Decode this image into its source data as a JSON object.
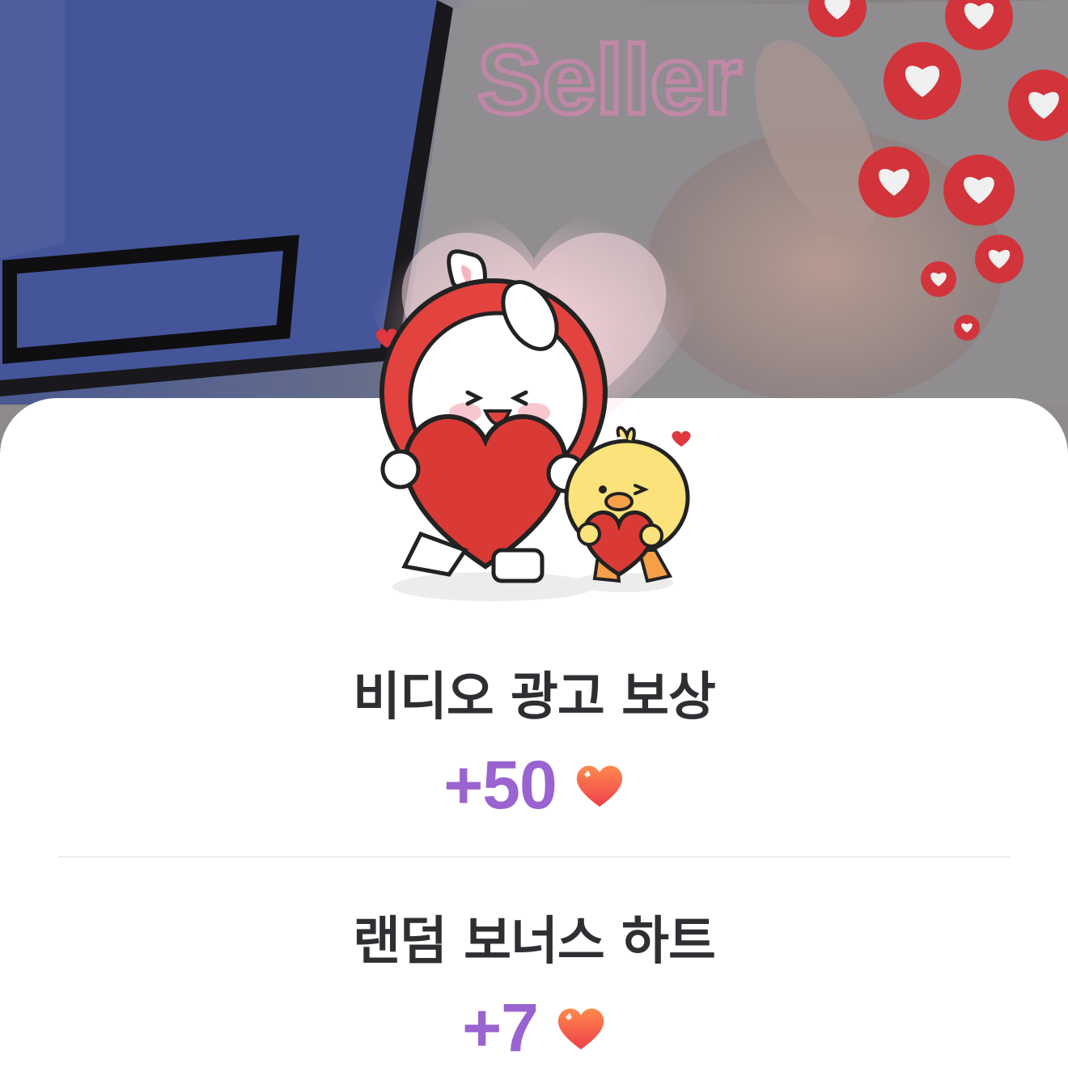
{
  "background": {
    "description_icon": "video-frame",
    "floating_hearts_icon": "heart-bubbles-icon"
  },
  "mascot": {
    "icon": "rabbit-and-chick-holding-hearts-icon"
  },
  "rewards": [
    {
      "title": "비디오 광고 보상",
      "amount": "+50",
      "icon": "heart-icon"
    },
    {
      "title": "랜덤 보너스 하트",
      "amount": "+7",
      "icon": "heart-icon"
    }
  ],
  "colors": {
    "accent": "#9a63d0",
    "title": "#2f2f33",
    "heart_top": "#ff7a4a",
    "heart_bottom": "#f0434b"
  }
}
